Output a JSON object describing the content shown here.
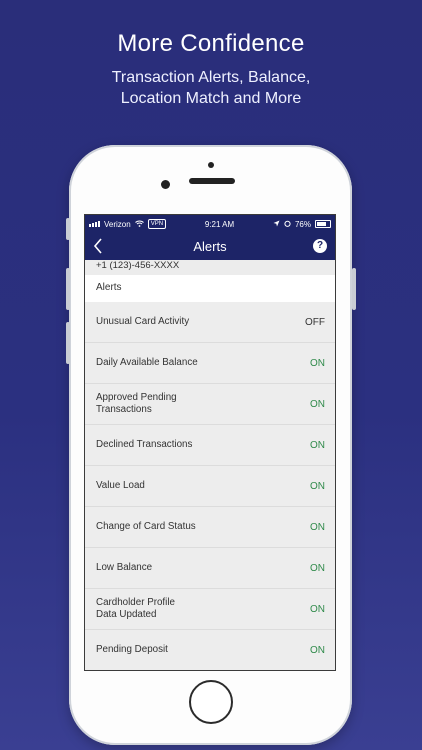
{
  "headline": {
    "title": "More Confidence",
    "subtitle_line1": "Transaction Alerts, Balance,",
    "subtitle_line2": "Location Match and More"
  },
  "status_bar": {
    "carrier": "Verizon",
    "vpn": "VPN",
    "time": "9:21 AM",
    "battery": "76%"
  },
  "nav": {
    "title": "Alerts",
    "help": "?"
  },
  "phone_number": "+1 (123)-456-XXXX",
  "section_header": "Alerts",
  "alerts": [
    {
      "label": "Unusual Card Activity",
      "value": "OFF"
    },
    {
      "label": "Daily Available Balance",
      "value": "ON"
    },
    {
      "label": "Approved Pending Transactions",
      "value": "ON"
    },
    {
      "label": "Declined Transactions",
      "value": "ON"
    },
    {
      "label": "Value Load",
      "value": "ON"
    },
    {
      "label": "Change of Card Status",
      "value": "ON"
    },
    {
      "label": "Low Balance",
      "value": "ON"
    },
    {
      "label": "Cardholder Profile Data Updated",
      "value": "ON"
    },
    {
      "label": "Pending Deposit",
      "value": "ON"
    }
  ],
  "colors": {
    "background": "#2b3080",
    "nav_bar": "#1d2467",
    "on_green": "#2f8a4a"
  }
}
